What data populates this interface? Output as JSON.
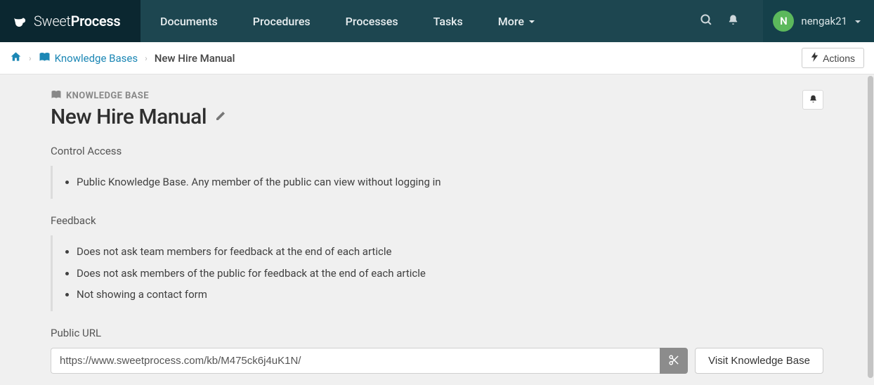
{
  "brand": {
    "light": "Sweet",
    "bold": "Process"
  },
  "nav": {
    "items": [
      {
        "label": "Documents"
      },
      {
        "label": "Procedures"
      },
      {
        "label": "Processes"
      },
      {
        "label": "Tasks"
      },
      {
        "label": "More"
      }
    ]
  },
  "user": {
    "initial": "N",
    "name": "nengak21"
  },
  "breadcrumb": {
    "link": "Knowledge Bases",
    "current": "New Hire Manual"
  },
  "actions_label": "Actions",
  "kb": {
    "eyebrow": "KNOWLEDGE BASE",
    "title": "New Hire Manual",
    "sections": {
      "control_access": {
        "label": "Control Access",
        "items": [
          "Public Knowledge Base. Any member of the public can view without logging in"
        ]
      },
      "feedback": {
        "label": "Feedback",
        "items": [
          "Does not ask team members for feedback at the end of each article",
          "Does not ask members of the public for feedback at the end of each article",
          "Not showing a contact form"
        ]
      },
      "public_url": {
        "label": "Public URL",
        "value": "https://www.sweetprocess.com/kb/M475ck6j4uK1N/",
        "visit_label": "Visit Knowledge Base"
      }
    }
  }
}
